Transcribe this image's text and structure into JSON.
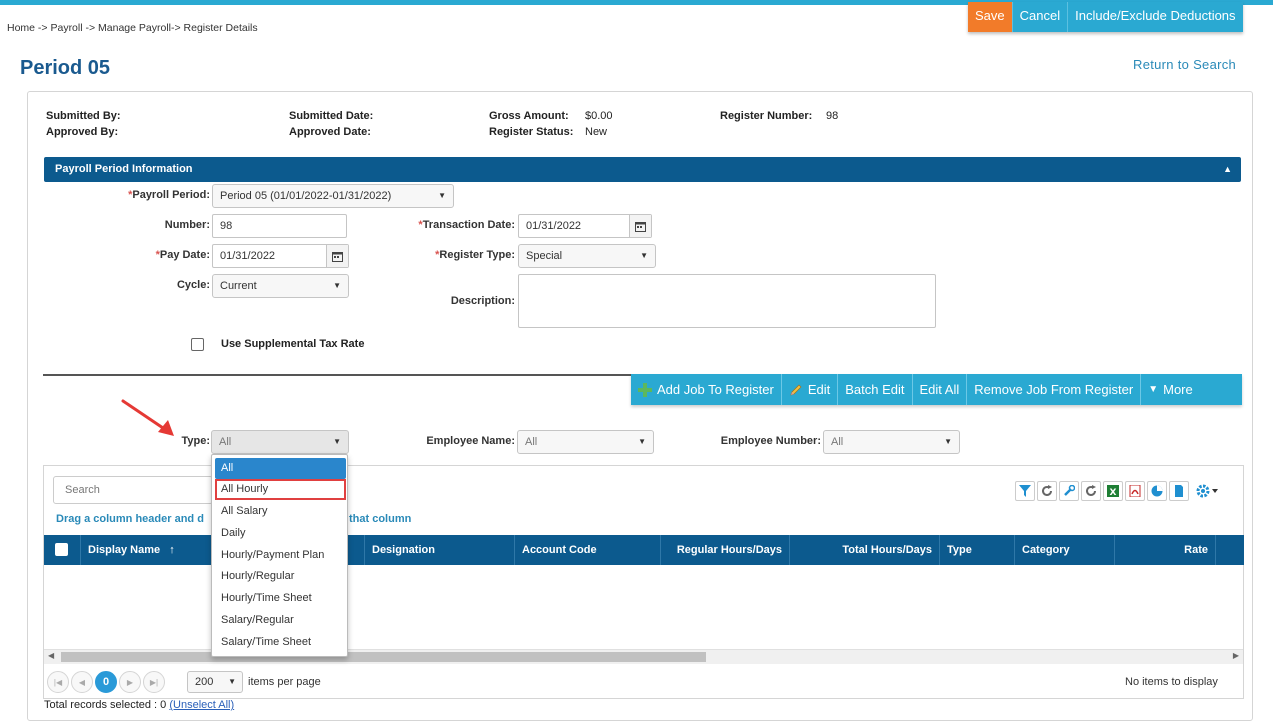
{
  "breadcrumb": "Home -> Payroll -> Manage Payroll-> Register Details",
  "actions": {
    "save": "Save",
    "cancel": "Cancel",
    "include_exclude": "Include/Exclude Deductions"
  },
  "page_title": "Period 05",
  "return_link": "Return to Search",
  "register_info": {
    "submitted_by_label": "Submitted By:",
    "approved_by_label": "Approved By:",
    "submitted_date_label": "Submitted Date:",
    "approved_date_label": "Approved Date:",
    "gross_amount_label": "Gross Amount:",
    "gross_amount": "$0.00",
    "register_status_label": "Register Status:",
    "register_status": "New",
    "register_number_label": "Register Number:",
    "register_number": "98"
  },
  "section": {
    "title": "Payroll Period Information"
  },
  "form": {
    "payroll_period_label": "Payroll Period:",
    "payroll_period": "Period 05 (01/01/2022-01/31/2022)",
    "number_label": "Number:",
    "number": "98",
    "pay_date_label": "Pay Date:",
    "pay_date": "01/31/2022",
    "cycle_label": "Cycle:",
    "cycle": "Current",
    "transaction_date_label": "Transaction Date:",
    "transaction_date": "01/31/2022",
    "register_type_label": "Register Type:",
    "register_type": "Special",
    "description_label": "Description:",
    "supplemental_label": "Use Supplemental Tax Rate",
    "required_mark": "*"
  },
  "job_toolbar": {
    "add_job": "Add Job To Register",
    "edit": "Edit",
    "batch_edit": "Batch Edit",
    "edit_all": "Edit All",
    "remove_job": "Remove Job From Register",
    "more": "More"
  },
  "filters": {
    "type_label": "Type:",
    "type_value": "All",
    "employee_name_label": "Employee Name:",
    "employee_name_value": "All",
    "employee_number_label": "Employee Number:",
    "employee_number_value": "All"
  },
  "type_options": [
    "All",
    "All Hourly",
    "All Salary",
    "Daily",
    "Hourly/Payment Plan",
    "Hourly/Regular",
    "Hourly/Time Sheet",
    "Salary/Regular",
    "Salary/Time Sheet"
  ],
  "grid": {
    "search_placeholder": "Search",
    "drag_hint_left": "Drag a column header and d",
    "drag_hint_right": "that column",
    "columns": [
      "Display Name",
      "Designation",
      "Account Code",
      "Regular Hours/Days",
      "Total Hours/Days",
      "Type",
      "Category",
      "Rate"
    ],
    "sort_indicator": "↑",
    "current_page": "0",
    "page_size": "200",
    "items_per_page": "items per page",
    "no_items": "No items to display"
  },
  "records": {
    "text": "Total records selected : 0",
    "unselect": "(Unselect All)"
  },
  "colors": {
    "accent": "#2aa9d2",
    "header": "#0c5a8e",
    "save": "#f27b29",
    "highlight": "#e04040"
  }
}
